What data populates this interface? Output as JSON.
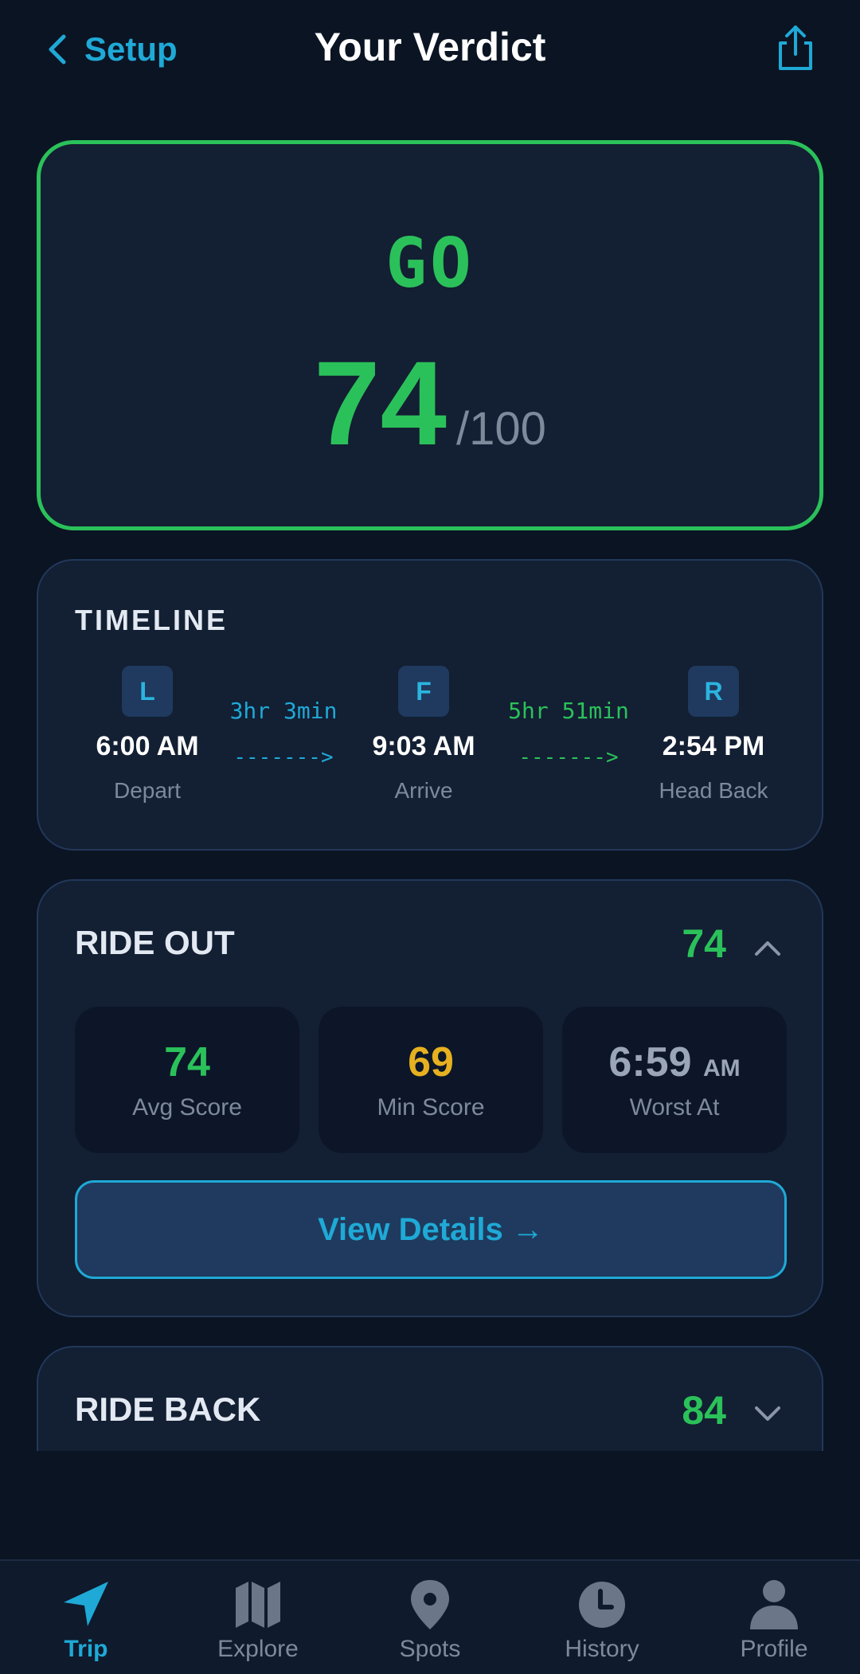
{
  "header": {
    "back_label": "Setup",
    "title": "Your Verdict"
  },
  "verdict": {
    "word": "GO",
    "score": "74",
    "score_suffix": "/100"
  },
  "timeline": {
    "title": "TIMELINE",
    "stops": [
      {
        "badge": "L",
        "time": "6:00 AM",
        "label": "Depart"
      },
      {
        "badge": "F",
        "time": "9:03 AM",
        "label": "Arrive"
      },
      {
        "badge": "R",
        "time": "2:54 PM",
        "label": "Head Back"
      }
    ],
    "legs": [
      {
        "duration": "3hr 3min",
        "arrow": "------->"
      },
      {
        "duration": "5hr 51min",
        "arrow": "------->"
      }
    ]
  },
  "ride_out": {
    "title": "RIDE OUT",
    "score": "74",
    "stats": [
      {
        "value": "74",
        "label": "Avg Score"
      },
      {
        "value": "69",
        "label": "Min Score"
      },
      {
        "value": "6:59",
        "value_suffix": "AM",
        "label": "Worst At"
      }
    ],
    "details_button": "View Details →"
  },
  "ride_back": {
    "title": "RIDE BACK",
    "score": "84"
  },
  "nav": {
    "items": [
      {
        "label": "Trip",
        "icon": "navigation-arrow-icon"
      },
      {
        "label": "Explore",
        "icon": "map-icon"
      },
      {
        "label": "Spots",
        "icon": "location-pin-icon"
      },
      {
        "label": "History",
        "icon": "clock-icon"
      },
      {
        "label": "Profile",
        "icon": "person-icon"
      }
    ],
    "active": "Trip"
  },
  "colors": {
    "background": "#0b1423",
    "card": "#131f33",
    "accent": "#1fa9d6",
    "go_green": "#2bc15a",
    "warning_yellow": "#e6b020",
    "muted": "#7d8a9c"
  }
}
